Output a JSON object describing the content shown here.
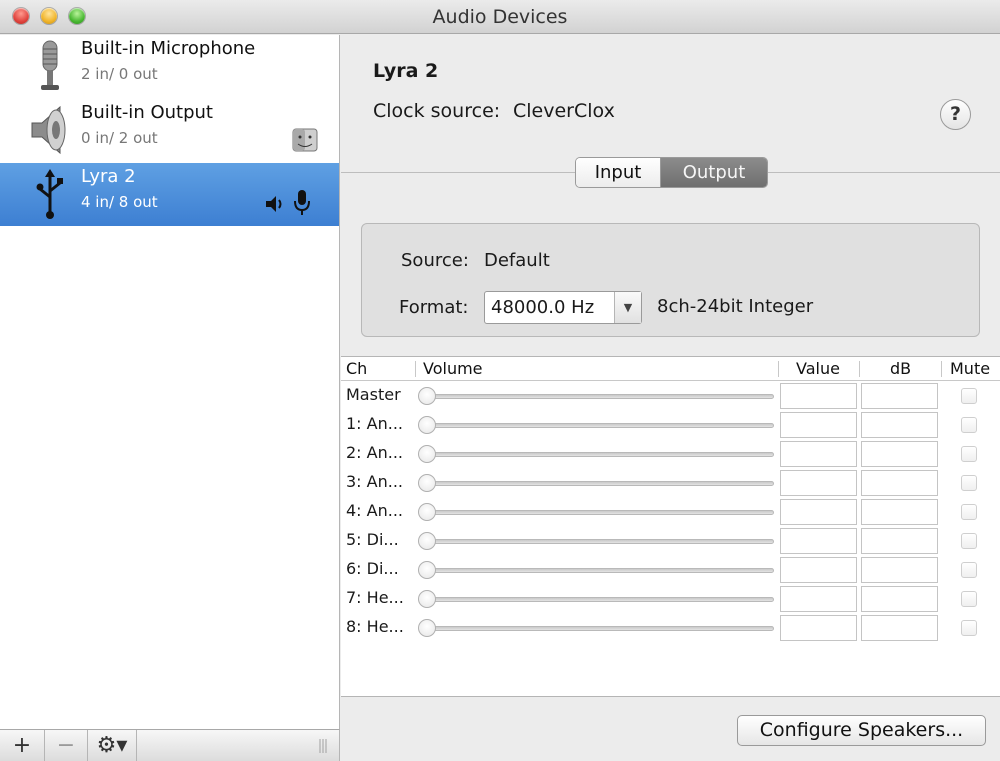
{
  "window": {
    "title": "Audio Devices"
  },
  "sidebar": {
    "devices": [
      {
        "name": "Built-in Microphone",
        "io": "2 in/ 0 out",
        "icon": "microphone-icon"
      },
      {
        "name": "Built-in Output",
        "io": "0 in/ 2 out",
        "icon": "speaker-icon"
      },
      {
        "name": "Lyra 2",
        "io": "4 in/ 8 out",
        "icon": "usb-icon"
      }
    ],
    "selected_index": 2,
    "bottom_bar": {
      "add": "+",
      "remove": "−",
      "gear": "⚙▾"
    }
  },
  "detail": {
    "device_name": "Lyra 2",
    "clock_source_label": "Clock source:",
    "clock_source_value": "CleverClox",
    "help": "?",
    "tabs": [
      {
        "label": "Input"
      },
      {
        "label": "Output"
      }
    ],
    "active_tab": "Output",
    "source_label": "Source:",
    "source_value": "Default",
    "format_label": "Format:",
    "format_value": "48000.0 Hz",
    "format_desc": "8ch-24bit Integer"
  },
  "table": {
    "headers": {
      "ch": "Ch",
      "volume": "Volume",
      "value": "Value",
      "db": "dB",
      "mute": "Mute"
    },
    "rows": [
      {
        "ch": "Master"
      },
      {
        "ch": "1: An..."
      },
      {
        "ch": "2: An..."
      },
      {
        "ch": "3: An..."
      },
      {
        "ch": "4: An..."
      },
      {
        "ch": "5: Di..."
      },
      {
        "ch": "6: Di..."
      },
      {
        "ch": "7: He..."
      },
      {
        "ch": "8: He..."
      }
    ]
  },
  "footer": {
    "configure_label": "Configure Speakers..."
  },
  "colors": {
    "selection": "#3d7fd2",
    "window_bg": "#ececec"
  }
}
